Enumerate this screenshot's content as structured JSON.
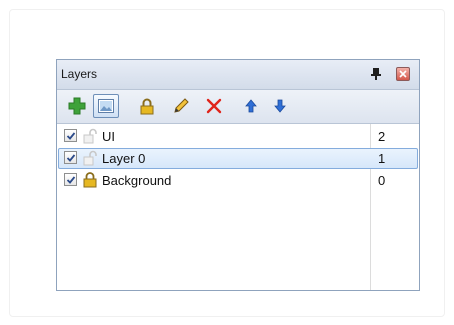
{
  "panel": {
    "title": "Layers"
  },
  "toolbar": {
    "buttons": [
      {
        "name": "add-layer-button",
        "icon": "plus-icon"
      },
      {
        "name": "layer-properties-button",
        "icon": "image-icon",
        "active": true
      },
      {
        "name": "lock-layer-button",
        "icon": "lock-icon"
      },
      {
        "name": "rename-layer-button",
        "icon": "pencil-icon"
      },
      {
        "name": "delete-layer-button",
        "icon": "delete-x-icon"
      },
      {
        "name": "move-layer-up-button",
        "icon": "arrow-up-icon"
      },
      {
        "name": "move-layer-down-button",
        "icon": "arrow-down-icon"
      }
    ]
  },
  "layers": [
    {
      "name": "UI",
      "number": "2",
      "visible": true,
      "locked": false,
      "selected": false
    },
    {
      "name": "Layer 0",
      "number": "1",
      "visible": true,
      "locked": false,
      "selected": true
    },
    {
      "name": "Background",
      "number": "0",
      "visible": true,
      "locked": true,
      "selected": false
    }
  ],
  "colors": {
    "selection_border": "#84acdd",
    "selection_fill": "#d6e7fa",
    "panel_border": "#8fa3bd",
    "add_green": "#3ea23a",
    "delete_red": "#e0241b",
    "arrow_blue": "#2f6fd6"
  }
}
